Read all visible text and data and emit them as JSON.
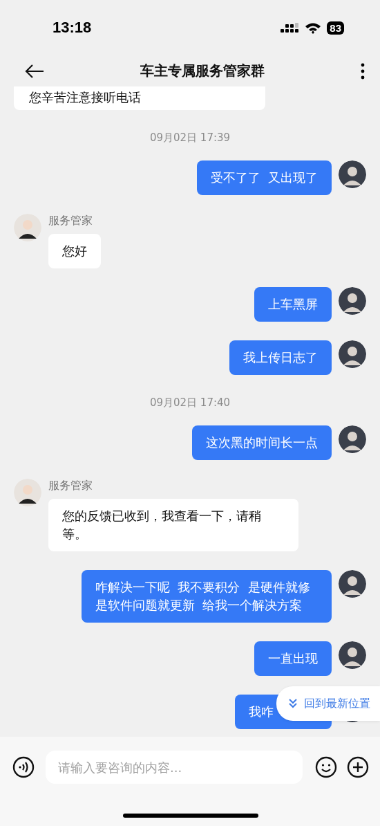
{
  "status_bar": {
    "time": "13:18",
    "battery": "83"
  },
  "header": {
    "title": "车主专属服务管家群"
  },
  "messages": [
    {
      "kind": "received",
      "text": "您辛苦注意接听电话"
    },
    {
      "kind": "time",
      "text": "09月02日 17:39"
    },
    {
      "kind": "sent",
      "text": "受不了了  又出现了"
    },
    {
      "kind": "received",
      "sender": "服务管家",
      "text": "您好"
    },
    {
      "kind": "sent",
      "text": "上车黑屏"
    },
    {
      "kind": "sent",
      "text": "我上传日志了"
    },
    {
      "kind": "time",
      "text": "09月02日 17:40"
    },
    {
      "kind": "sent",
      "text": "这次黑的时间长一点"
    },
    {
      "kind": "received",
      "sender": "服务管家",
      "text": "您的反馈已收到，我查看一下，请稍等。"
    },
    {
      "kind": "sent",
      "text": "咋解决一下呢  我不要积分  是硬件就修是软件问题就更新  给我一个解决方案"
    },
    {
      "kind": "sent",
      "text": "一直出现"
    },
    {
      "kind": "sent",
      "text": "我咋"
    }
  ],
  "jump_button": {
    "label": "回到最新位置"
  },
  "input": {
    "placeholder": "请输入要咨询的内容..."
  }
}
